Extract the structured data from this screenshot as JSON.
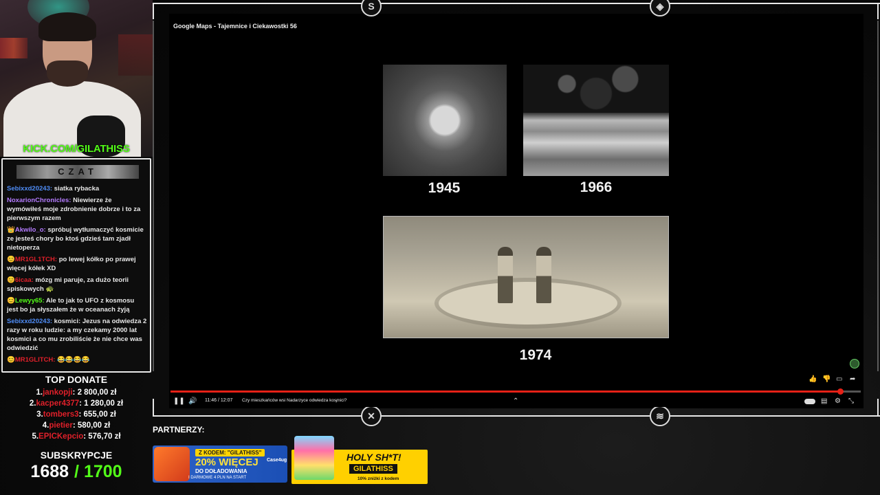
{
  "webcam": {
    "channel_url": "KICK.COM/GILATHISS"
  },
  "chat": {
    "header": "CZAT",
    "messages": [
      {
        "user": "Sebixxd20243:",
        "text": "siatka rybacka",
        "color": "#4f8df7"
      },
      {
        "user": "NoxarionChronicles:",
        "text": "Niewierze że wymówiłeś moje zdrobnienie dobrze i to za pierwszym razem",
        "color": "#b57cff"
      },
      {
        "user": "👑Akwilo_o:",
        "text": "spróbuj wytłumaczyć kosmicie ze jesteś chory bo ktoś gdzieś tam zjadł nietoperza",
        "color": "#b57cff"
      },
      {
        "user": "😊MR1GL1TCH:",
        "text": "po lewej kółko po prawej więcej kółek XD",
        "color": "#e0202a"
      },
      {
        "user": "😊6icaa:",
        "text": "mózg mi paruje, za dużo teorii spiskowych 🐢",
        "color": "#e0202a"
      },
      {
        "user": "😊Lewyy65:",
        "text": "Ale to jak to UFO z kosmosu jest bo ja słyszałem że w oceanach żyją",
        "color": "#53fc18"
      },
      {
        "user": "Sebixxd20243:",
        "text": "kosmici: Jezus na odwiedza 2 razy w roku ludzie: a my czekamy 2000 lat kosmici a co mu zrobiliście że nie chce was odwiedzić",
        "color": "#4f8df7"
      },
      {
        "user": "😊MR1GLITCH:",
        "text": "😂😂😂😂",
        "color": "#e0202a"
      }
    ]
  },
  "donate": {
    "title": "TOP DONATE",
    "rows": [
      {
        "rank": "1.",
        "name": "jankopji",
        "amount": ": 2 800,00 zł"
      },
      {
        "rank": "2.",
        "name": "kacper4377",
        "amount": ": 1 280,00 zł"
      },
      {
        "rank": "3.",
        "name": "tombers3",
        "amount": ": 655,00 zł"
      },
      {
        "rank": "4.",
        "name": "pietier",
        "amount": ": 580,00 zł"
      },
      {
        "rank": "5.",
        "name": "EPICKepcio",
        "amount": ": 576,70 zł"
      }
    ]
  },
  "subs": {
    "title": "SUBSKRYPCJE",
    "current": "1688",
    "goal": "/ 1700"
  },
  "video": {
    "title": "Google Maps - Tajemnice i Ciekawostki 56",
    "years": [
      "1945",
      "1966",
      "1974"
    ],
    "time": "11:46 / 12:07",
    "chapter": "Czy mieszkańców wsi Nadarzyce odwiedza kosmici?",
    "progress_fraction": 0.97
  },
  "partners": {
    "label": "PARTNERZY:",
    "banner1": {
      "code": "Z KODEM: \"GILATHISS\"",
      "headline": "20% WIĘCEJ",
      "line2": "DO DOŁADOWANIA",
      "line3": "I DARMOWE 4 PLN NA START",
      "brand": "Case4ug"
    },
    "banner2": {
      "headline": "HOLY SH*T!",
      "tag": "GILATHISS",
      "sub": "10% zniżki z kodem"
    }
  },
  "colors": {
    "kick_green": "#53fc18",
    "progress_red": "#e62117",
    "donate_red": "#e0202a"
  }
}
